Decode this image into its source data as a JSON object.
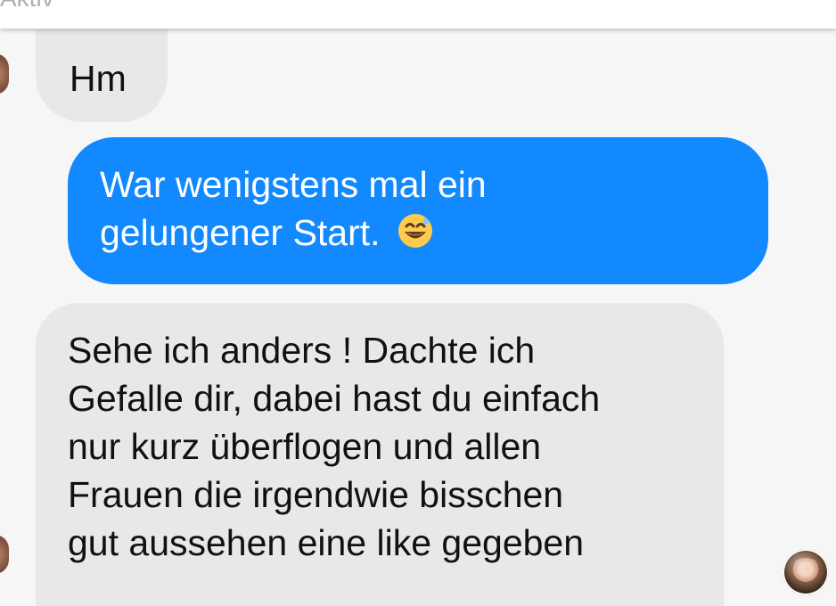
{
  "header": {
    "status_text": "Aktiv"
  },
  "messages": [
    {
      "sender": "incoming",
      "text": "Hm"
    },
    {
      "sender": "outgoing",
      "text": "War wenigstens mal ein gelungener Start.",
      "lines": [
        "War wenigstens mal ein",
        "gelungener Start."
      ],
      "emoji": "grinning-sweat-emoji"
    },
    {
      "sender": "incoming",
      "text": "Sehe ich anders ! Dachte ich Gefalle dir, dabei hast du einfach nur kurz überflogen und allen Frauen die irgendwie bisschen gut aussehen eine like gegeben",
      "lines": [
        "Sehe ich anders ! Dachte ich",
        "Gefalle dir, dabei hast du einfach",
        "nur kurz überflogen und allen",
        "Frauen die irgendwie bisschen",
        "gut aussehen eine like gegeben"
      ]
    }
  ],
  "colors": {
    "outgoing_bubble": "#1289ff",
    "incoming_bubble": "#e8e8e8",
    "background": "#f6f6f6"
  },
  "icons": {
    "left_avatar": "avatar-icon",
    "right_avatar": "seen-avatar-icon"
  }
}
